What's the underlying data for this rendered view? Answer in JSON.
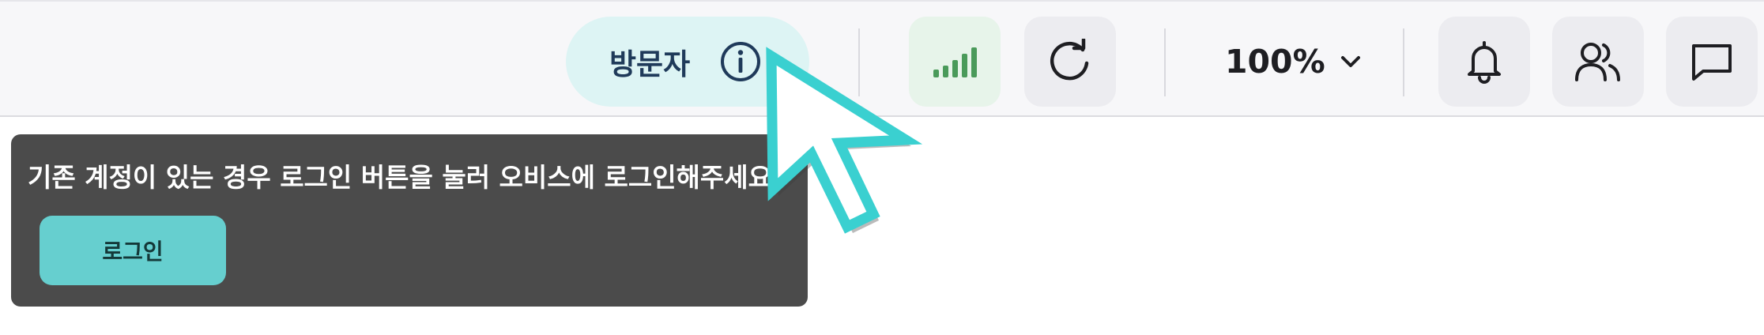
{
  "header": {
    "visitor": {
      "label": "방문자",
      "icon": "info-icon"
    },
    "signal": {
      "icon": "signal-strength-icon",
      "color": "#4a9a5a"
    },
    "refresh": {
      "icon": "refresh-icon"
    },
    "zoom": {
      "value": "100%",
      "icon": "chevron-down-icon"
    },
    "notifications": {
      "icon": "bell-icon"
    },
    "participants": {
      "icon": "users-icon"
    },
    "chat": {
      "icon": "chat-icon"
    }
  },
  "tooltip": {
    "message": "기존 계정이 있는 경우 로그인 버튼을 눌러 오비스에 로그인해주세요",
    "login_label": "로그인"
  },
  "colors": {
    "accent": "#66cfcf",
    "visitor_pill_bg": "#ddf4f4",
    "tooltip_bg": "#4b4b4b",
    "cursor": "#3ad0d0"
  }
}
